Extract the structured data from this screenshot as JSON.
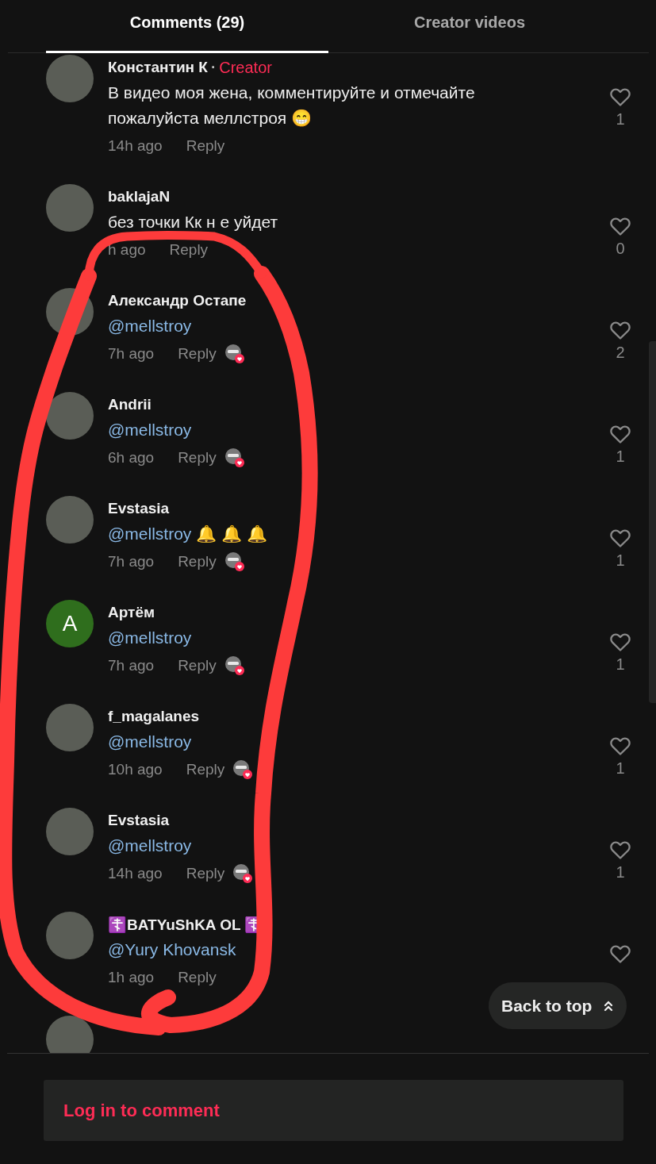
{
  "tabs": [
    {
      "label": "Comments (29)",
      "selected": true
    },
    {
      "label": "Creator videos",
      "selected": false
    }
  ],
  "comments": [
    {
      "kind": "comment",
      "author": "Константин К",
      "separator": "·",
      "badge": "Creator",
      "text": "В видео моя жена, комментируйте и отмечайте пожалуйста меллстроя 😁",
      "time": "14h ago",
      "reply": "Reply",
      "liked_by_creator": false,
      "likes": "1"
    },
    {
      "kind": "comment",
      "author": "baklajaN",
      "text": "без точки Кк н е уйдет",
      "time": "h ago",
      "reply": "Reply",
      "liked_by_creator": false,
      "likes": "0"
    },
    {
      "kind": "comment",
      "author": "Александр Остапе",
      "mention": "@mellstroy",
      "time": "7h ago",
      "reply": "Reply",
      "liked_by_creator": true,
      "likes": "2"
    },
    {
      "kind": "comment",
      "author": "Andrii",
      "mention": "@mellstroy",
      "time": "6h ago",
      "reply": "Reply",
      "liked_by_creator": true,
      "likes": "1"
    },
    {
      "kind": "comment",
      "author": "Evstasia",
      "mention": "@mellstroy",
      "text": "🔔 🔔 🔔",
      "time": "7h ago",
      "reply": "Reply",
      "liked_by_creator": true,
      "likes": "1"
    },
    {
      "kind": "comment",
      "author": "Артём",
      "avatar_letter": "A",
      "mention": "@mellstroy",
      "time": "7h ago",
      "reply": "Reply",
      "liked_by_creator": true,
      "likes": "1"
    },
    {
      "kind": "comment",
      "author": "f_magalanes",
      "mention": "@mellstroy",
      "time": "10h ago",
      "reply": "Reply",
      "liked_by_creator": true,
      "likes": "1"
    },
    {
      "kind": "comment",
      "author": "Evstasia",
      "mention": "@mellstroy",
      "time": "14h ago",
      "reply": "Reply",
      "liked_by_creator": true,
      "likes": "1"
    },
    {
      "kind": "comment",
      "author": "☦️BATYuShKA OL",
      "author_end": "☦️",
      "mention": "@Yury Khovansk",
      "time": "1h ago",
      "reply": "Reply",
      "liked_by_creator": false
    },
    {
      "kind": "clipped"
    }
  ],
  "back_to_top": "Back to top",
  "login_prompt": "Log in to comment"
}
